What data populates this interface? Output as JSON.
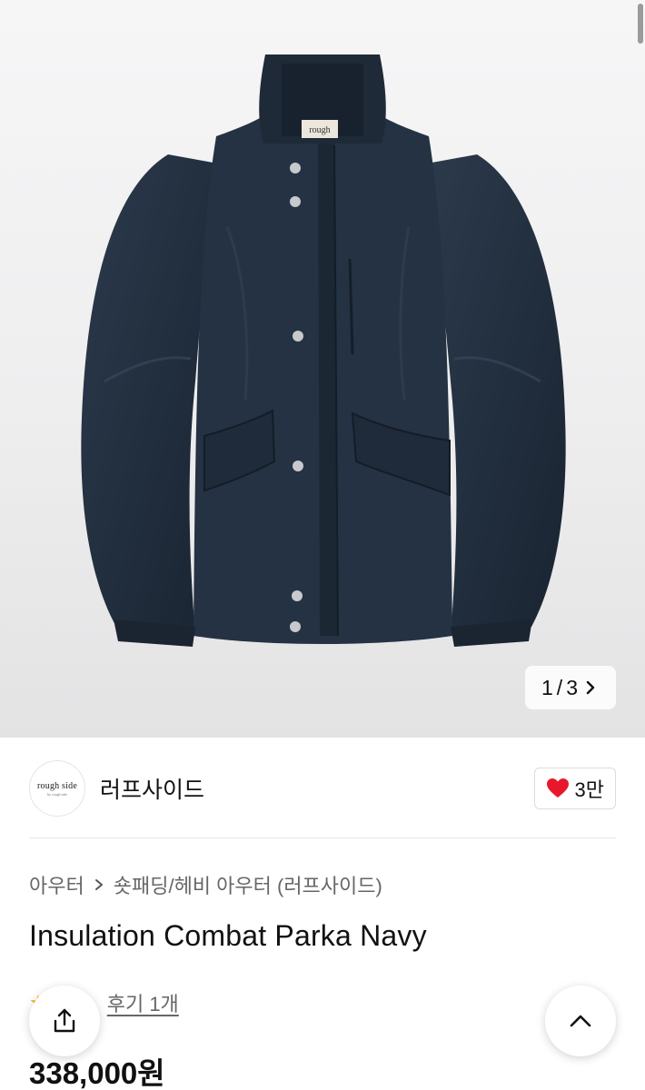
{
  "gallery": {
    "current": "1",
    "separator": "/",
    "total": "3",
    "shirt_label": "rough"
  },
  "brand": {
    "logo_text": "rough side",
    "logo_subtext": "by rough side",
    "name": "러프사이드",
    "likes": "3만",
    "heart_color": "#e8182c"
  },
  "breadcrumb": {
    "category": "아우터",
    "subcategory": "숏패딩/헤비 아우터 (러프사이드)"
  },
  "product": {
    "title": "Insulation Combat Parka Navy",
    "reviews": "후기 1개",
    "price": "338,000원"
  },
  "icons": {
    "share": "share-icon",
    "scroll_top": "chevron-up-icon",
    "pager_next": "chevron-right-icon"
  }
}
